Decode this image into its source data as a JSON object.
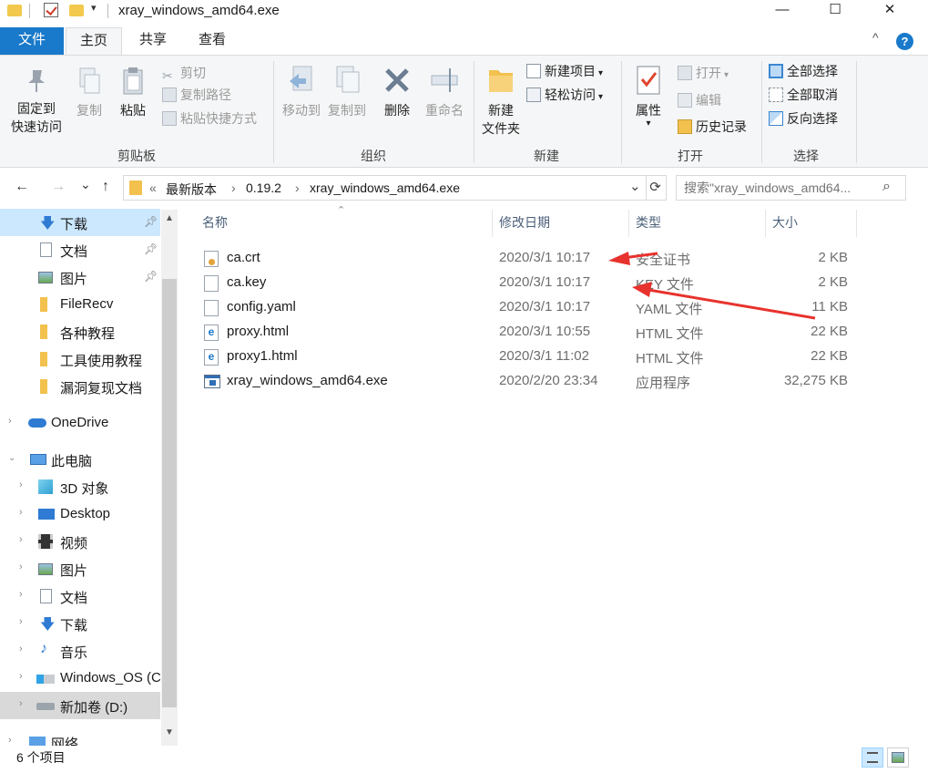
{
  "window": {
    "title": "xray_windows_amd64.exe",
    "minimize": "—",
    "maximize": "☐",
    "close": "✕"
  },
  "ribbon": {
    "tabs": [
      "文件",
      "主页",
      "共享",
      "查看"
    ],
    "collapse": "^",
    "help": "?",
    "clipboard": {
      "group": "剪贴板",
      "pin_line1": "固定到",
      "pin_line2": "快速访问",
      "copy": "复制",
      "paste": "粘贴",
      "cut": "剪切",
      "copy_path": "复制路径",
      "paste_shortcut": "粘贴快捷方式"
    },
    "organize": {
      "group": "组织",
      "move_to": "移动到",
      "copy_to": "复制到",
      "delete": "删除",
      "rename": "重命名"
    },
    "new": {
      "group": "新建",
      "new_folder_line1": "新建",
      "new_folder_line2": "文件夹",
      "new_item": "新建项目",
      "easy_access": "轻松访问"
    },
    "open": {
      "group": "打开",
      "properties": "属性",
      "open": "打开",
      "edit": "编辑",
      "history": "历史记录"
    },
    "select": {
      "group": "选择",
      "select_all": "全部选择",
      "select_none": "全部取消",
      "invert": "反向选择"
    }
  },
  "address": {
    "back": "←",
    "forward": "→",
    "recent": "⌄",
    "up": "↑",
    "overflow": "«",
    "crumbs": [
      "最新版本",
      "0.19.2",
      "xray_windows_amd64.exe"
    ],
    "sep": "›",
    "dropdown": "⌄",
    "refresh": "⟳",
    "search_placeholder": "搜索\"xray_windows_amd64...",
    "search_icon": "⌕"
  },
  "nav": {
    "items": [
      {
        "label": "下载",
        "icon": "download-icon"
      },
      {
        "label": "文档",
        "icon": "document-icon"
      },
      {
        "label": "图片",
        "icon": "pictures-icon"
      },
      {
        "label": "FileRecv",
        "icon": "folder-icon"
      },
      {
        "label": "各种教程",
        "icon": "folder-icon"
      },
      {
        "label": "工具使用教程",
        "icon": "folder-icon"
      },
      {
        "label": "漏洞复现文档",
        "icon": "folder-icon"
      },
      {
        "label": "OneDrive",
        "icon": "cloud-icon"
      },
      {
        "label": "此电脑",
        "icon": "computer-icon"
      },
      {
        "label": "3D 对象",
        "icon": "cube-icon"
      },
      {
        "label": "Desktop",
        "icon": "desktop-icon"
      },
      {
        "label": "视频",
        "icon": "video-icon"
      },
      {
        "label": "图片",
        "icon": "pictures-icon"
      },
      {
        "label": "文档",
        "icon": "document-icon"
      },
      {
        "label": "下载",
        "icon": "download-icon"
      },
      {
        "label": "音乐",
        "icon": "music-icon"
      },
      {
        "label": "Windows_OS (C",
        "icon": "drive-icon"
      },
      {
        "label": "新加卷 (D:)",
        "icon": "drive-icon"
      },
      {
        "label": "网络",
        "icon": "network-icon"
      }
    ]
  },
  "columns": {
    "name": "名称",
    "date": "修改日期",
    "type": "类型",
    "size": "大小"
  },
  "files": [
    {
      "name": "ca.crt",
      "date": "2020/3/1 10:17",
      "type": "安全证书",
      "size": "2 KB",
      "icon": "certificate-icon"
    },
    {
      "name": "ca.key",
      "date": "2020/3/1 10:17",
      "type": "KEY 文件",
      "size": "2 KB",
      "icon": "file-icon"
    },
    {
      "name": "config.yaml",
      "date": "2020/3/1 10:17",
      "type": "YAML 文件",
      "size": "11 KB",
      "icon": "file-icon"
    },
    {
      "name": "proxy.html",
      "date": "2020/3/1 10:55",
      "type": "HTML 文件",
      "size": "22 KB",
      "icon": "edge-html-icon"
    },
    {
      "name": "proxy1.html",
      "date": "2020/3/1 11:02",
      "type": "HTML 文件",
      "size": "22 KB",
      "icon": "edge-html-icon"
    },
    {
      "name": "xray_windows_amd64.exe",
      "date": "2020/2/20 23:34",
      "type": "应用程序",
      "size": "32,275 KB",
      "icon": "application-icon"
    }
  ],
  "status": {
    "count": "6 个项目"
  },
  "colors": {
    "accent": "#1979ca",
    "ribbon_bg": "#f5f6f7",
    "annotation_arrow": "#e8322d",
    "selected_nav": "#cce8ff"
  }
}
